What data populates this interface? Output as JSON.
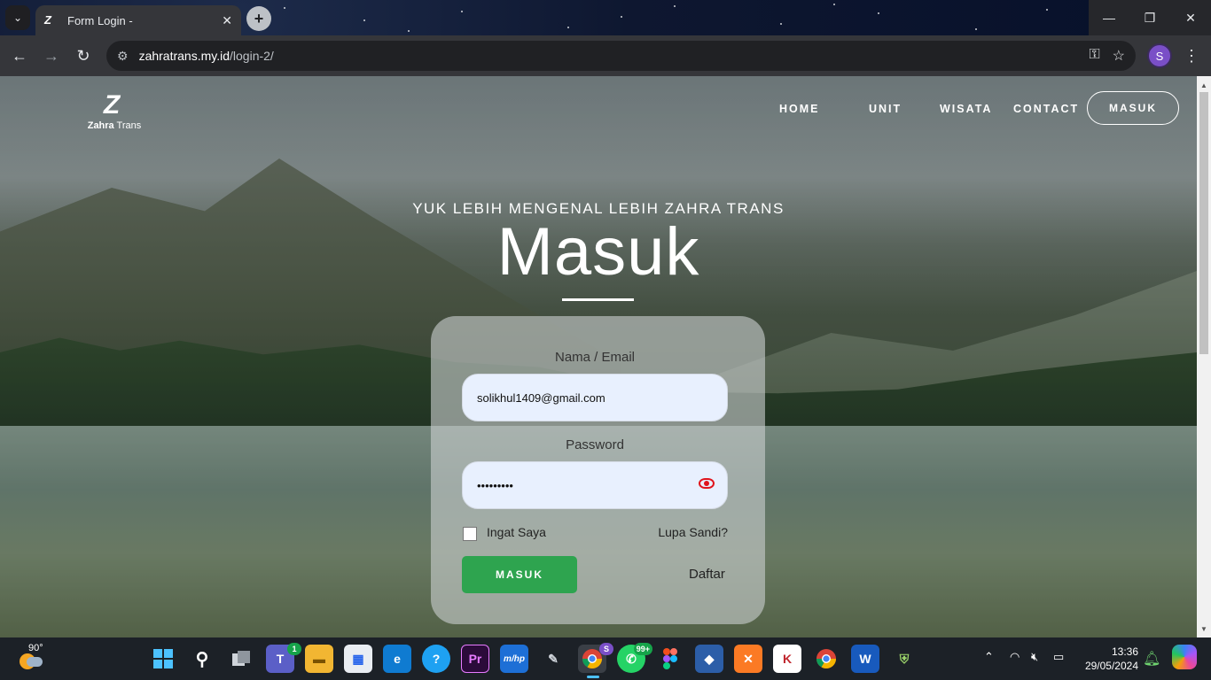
{
  "browser": {
    "tab_title": "Form Login -",
    "tab_close": "✕",
    "new_tab": "+",
    "tab_menu": "⌄",
    "url_host": "zahratrans.my.id",
    "url_path": "/login-2/",
    "profile_initial": "S",
    "window_controls": {
      "minimize": "—",
      "restore": "❐",
      "close": "✕"
    }
  },
  "site": {
    "logo_mark": "Z",
    "logo_bold": "Zahra",
    "logo_rest": " Trans",
    "nav": {
      "home": "HOME",
      "unit": "UNIT",
      "wisata": "WISATA",
      "contact": "CONTACT",
      "login_button": "MASUK"
    },
    "subtitle": "YUK LEBIH MENGENAL LEBIH ZAHRA TRANS",
    "heading": "Masuk"
  },
  "form": {
    "email_label": "Nama / Email",
    "email_value": "solikhul1409@gmail.com",
    "password_label": "Password",
    "password_value": "•••••••••",
    "remember_label": "Ingat Saya",
    "forgot_label": "Lupa Sandi?",
    "submit_label": "MASUK",
    "register_label": "Daftar"
  },
  "taskbar": {
    "weather_temp": "90°",
    "teams_badge": "1",
    "whatsapp_badge": "99+",
    "chrome_profile": "S",
    "time": "13:36",
    "date": "29/05/2024"
  },
  "colors": {
    "accent_green": "#2ea44f",
    "eye_icon_red": "#e0141c",
    "input_bg": "#e8f0fe"
  }
}
